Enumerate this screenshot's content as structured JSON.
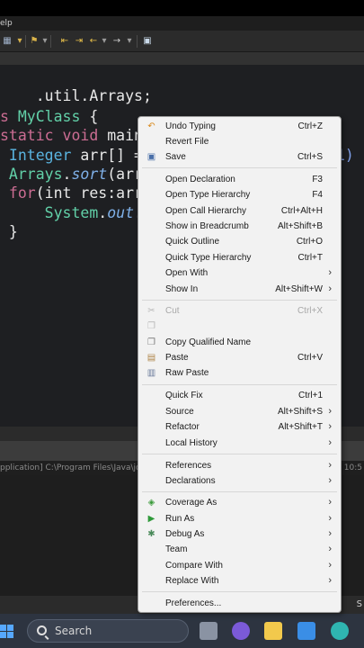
{
  "window": {
    "title_fragment": "elp"
  },
  "code": {
    "line1": ".util.Arrays;",
    "line2_kw": "s ",
    "line2_cls": "MyClass",
    "line2_rest": " {",
    "line3_kw": "static void ",
    "line3_rest": "main",
    "line4_type": " Integer",
    "line4_rest": " arr[] =",
    "line4_tail": "1)",
    "line5_cls": " Arrays",
    "line5_dot": ".",
    "line5_it": "sort",
    "line5_rest": "(arr",
    "line6_kw": " for",
    "line6_rest": "(int res:arr",
    "line7_cls": "     System",
    "line7_dot": ".",
    "line7_it": "out",
    "line7_rest": ".",
    "line8": " }"
  },
  "console": {
    "path": "pplication] C:\\Program Files\\Java\\jd",
    "time": "– 10:5"
  },
  "status": {
    "right": "S"
  },
  "taskbar": {
    "search_placeholder": "Search"
  },
  "menu": {
    "undo_typing": {
      "label": "Undo Typing",
      "shortcut": "Ctrl+Z"
    },
    "revert_file": {
      "label": "Revert File"
    },
    "save": {
      "label": "Save",
      "shortcut": "Ctrl+S"
    },
    "open_declaration": {
      "label": "Open Declaration",
      "shortcut": "F3"
    },
    "open_type_hierarchy": {
      "label": "Open Type Hierarchy",
      "shortcut": "F4"
    },
    "open_call_hierarchy": {
      "label": "Open Call Hierarchy",
      "shortcut": "Ctrl+Alt+H"
    },
    "show_in_breadcrumb": {
      "label": "Show in Breadcrumb",
      "shortcut": "Alt+Shift+B"
    },
    "quick_outline": {
      "label": "Quick Outline",
      "shortcut": "Ctrl+O"
    },
    "quick_type_hierarchy": {
      "label": "Quick Type Hierarchy",
      "shortcut": "Ctrl+T"
    },
    "open_with": {
      "label": "Open With"
    },
    "show_in": {
      "label": "Show In",
      "shortcut": "Alt+Shift+W"
    },
    "cut": {
      "label": "Cut",
      "shortcut": "Ctrl+X"
    },
    "copy_qualified_name": {
      "label": "Copy Qualified Name"
    },
    "paste": {
      "label": "Paste",
      "shortcut": "Ctrl+V"
    },
    "raw_paste": {
      "label": "Raw Paste"
    },
    "quick_fix": {
      "label": "Quick Fix",
      "shortcut": "Ctrl+1"
    },
    "source": {
      "label": "Source",
      "shortcut": "Alt+Shift+S"
    },
    "refactor": {
      "label": "Refactor",
      "shortcut": "Alt+Shift+T"
    },
    "local_history": {
      "label": "Local History"
    },
    "references": {
      "label": "References"
    },
    "declarations": {
      "label": "Declarations"
    },
    "coverage_as": {
      "label": "Coverage As"
    },
    "run_as": {
      "label": "Run As"
    },
    "debug_as": {
      "label": "Debug As"
    },
    "team": {
      "label": "Team"
    },
    "compare_with": {
      "label": "Compare With"
    },
    "replace_with": {
      "label": "Replace With"
    },
    "preferences": {
      "label": "Preferences..."
    },
    "submenu_arrow": "›"
  },
  "colors": {
    "editor_bg": "#1e1f22",
    "keyword": "#cc6d93",
    "type": "#5ab4e0",
    "class": "#62d0a8",
    "menu_bg": "#f2f2f2",
    "taskbar_bg": "#2d3440",
    "accent": "#56a8ff"
  },
  "icons": {
    "undo": "undo-icon",
    "save": "save-icon",
    "cut": "cut-icon",
    "copy": "copy-icon",
    "paste": "paste-icon",
    "coverage": "coverage-icon",
    "run": "run-icon",
    "debug": "debug-icon"
  }
}
